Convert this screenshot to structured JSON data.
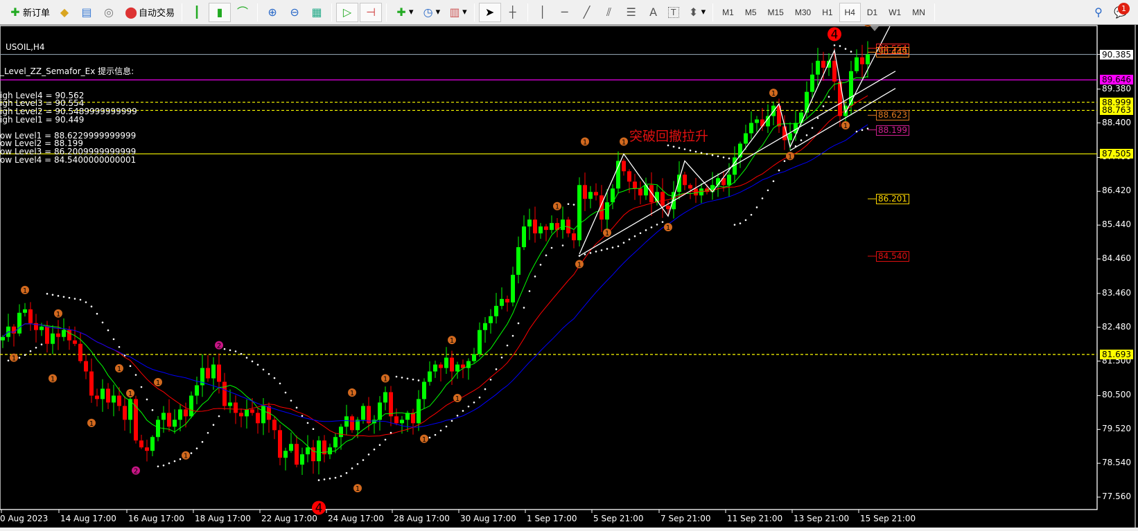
{
  "toolbar": {
    "new_order": "新订单",
    "auto_trading": "自动交易",
    "timeframes": [
      "M1",
      "M5",
      "M15",
      "M30",
      "H1",
      "H4",
      "D1",
      "W1",
      "MN"
    ],
    "active_timeframe": "H4",
    "notification_count": "1",
    "icons": [
      "new-order-icon",
      "market-watch-icon",
      "data-window-icon",
      "signals-icon",
      "auto-trading-icon",
      "bar-chart-icon",
      "candlestick-icon",
      "line-chart-icon",
      "zoom-in-icon",
      "zoom-out-icon",
      "tile-windows-icon",
      "auto-scroll-icon",
      "chart-shift-icon",
      "indicators-icon",
      "periods-icon",
      "templates-icon",
      "cursor-icon",
      "crosshair-icon",
      "vertical-line-icon",
      "horizontal-line-icon",
      "trendline-icon",
      "equidistant-channel-icon",
      "fibonacci-icon",
      "text-icon",
      "text-label-icon",
      "arrows-icon",
      "search-icon",
      "notifications-icon"
    ],
    "text_tool": "A",
    "text_label_tool": "T"
  },
  "chart": {
    "symbol": "USOIL,H4",
    "indicator_title": "_Level_ZZ_Semafor_Ex 提示信息:",
    "info_lines": [
      "igh Level4 = 90.562",
      "igh Level3 = 90.554",
      "igh Level2 = 90.5489999999999",
      "igh Level1 = 90.449",
      "",
      "ow Level1 = 88.6229999999999",
      "ow Level2 = 88.199",
      "ow Level3 = 86.2009999999999",
      "ow Level4 = 84.5400000000001"
    ],
    "annotation": "突破回撤拉升",
    "price_ticks": [
      "90.385",
      "89.380",
      "88.400",
      "87.400",
      "86.420",
      "85.440",
      "84.460",
      "83.460",
      "82.480",
      "81.500",
      "80.500",
      "79.520",
      "78.540",
      "77.560"
    ],
    "date_ticks": [
      "0 Aug 2023",
      "14 Aug 17:00",
      "16 Aug 17:00",
      "18 Aug 17:00",
      "22 Aug 17:00",
      "24 Aug 17:00",
      "28 Aug 17:00",
      "30 Aug 17:00",
      "1 Sep 17:00",
      "5 Sep 21:00",
      "7 Sep 21:00",
      "11 Sep 21:00",
      "13 Sep 21:00",
      "15 Sep 21:00"
    ],
    "hlines": [
      {
        "price": 90.385,
        "label": "90.385",
        "color": "#8a9aa8",
        "style": "solid",
        "label_bg": "#ffffff",
        "label_fg": "#000000"
      },
      {
        "price": 89.646,
        "label": "89.646",
        "color": "#ff00ff",
        "style": "solid",
        "label_bg": "#ff00ff",
        "label_fg": "#000000"
      },
      {
        "price": 88.999,
        "label": "88.999",
        "color": "#ffff00",
        "style": "dashed",
        "label_bg": "#ffff00",
        "label_fg": "#000000"
      },
      {
        "price": 88.763,
        "label": "88.763",
        "color": "#ffff00",
        "style": "dashed",
        "label_bg": "#ffff00",
        "label_fg": "#000000"
      },
      {
        "price": 87.505,
        "label": "87.505",
        "color": "#ffff00",
        "style": "solid",
        "label_bg": "#ffff00",
        "label_fg": "#000000"
      },
      {
        "price": 81.693,
        "label": "81.693",
        "color": "#ffff00",
        "style": "dashed",
        "label_bg": "#ffff00",
        "label_fg": "#000000"
      }
    ],
    "level_labels": [
      {
        "price": 90.562,
        "label": "90.554",
        "color": "#ff2020"
      },
      {
        "price": 90.449,
        "label": "90.449",
        "color": "#ff8c1a"
      },
      {
        "price": 88.623,
        "label": "88.623",
        "color": "#e07820"
      },
      {
        "price": 88.199,
        "label": "88.199",
        "color": "#d02090"
      },
      {
        "price": 86.201,
        "label": "86.201",
        "color": "#ffd700"
      },
      {
        "price": 84.54,
        "label": "84.540",
        "color": "#e01010"
      }
    ],
    "colors": {
      "bull": "#00ff00",
      "bear": "#ff0000",
      "ma_fast": "#00ff00",
      "ma_mid": "#ff0000",
      "ma_slow": "#0000ff",
      "sar": "#ffffff",
      "semafor1": "#d2691e",
      "semafor2": "#c71585",
      "semafor4": "#ff0000"
    }
  },
  "chart_data": {
    "type": "candlestick",
    "symbol": "USOIL",
    "timeframe": "H4",
    "ylim": [
      77.2,
      91.6
    ],
    "closes": [
      82.2,
      82.5,
      82.3,
      82.9,
      83.0,
      82.6,
      82.4,
      82.5,
      82.0,
      82.3,
      82.2,
      82.4,
      82.1,
      82.0,
      81.5,
      81.2,
      80.5,
      80.4,
      80.7,
      80.3,
      80.5,
      80.2,
      79.8,
      80.4,
      79.2,
      79.0,
      78.9,
      79.3,
      79.8,
      80.0,
      79.6,
      79.8,
      80.1,
      79.9,
      80.5,
      80.8,
      81.3,
      81.0,
      81.4,
      80.9,
      80.2,
      80.3,
      80.0,
      79.9,
      80.1,
      80.0,
      79.7,
      80.2,
      79.8,
      79.5,
      78.7,
      78.9,
      79.1,
      78.5,
      78.8,
      79.0,
      78.6,
      79.2,
      78.8,
      79.0,
      79.3,
      79.6,
      79.9,
      79.5,
      79.8,
      80.2,
      79.7,
      79.8,
      80.3,
      80.6,
      79.9,
      79.7,
      79.8,
      80.0,
      79.7,
      80.4,
      80.9,
      81.2,
      81.4,
      81.3,
      81.6,
      81.2,
      81.4,
      81.3,
      81.5,
      81.7,
      82.4,
      82.6,
      82.8,
      83.1,
      83.3,
      83.2,
      84.0,
      84.8,
      85.4,
      85.6,
      85.2,
      85.4,
      85.3,
      85.5,
      85.3,
      85.6,
      85.2,
      85.0,
      86.6,
      86.2,
      86.4,
      86.3,
      85.6,
      86.1,
      86.5,
      87.3,
      87.0,
      86.7,
      86.5,
      86.3,
      86.6,
      86.1,
      86.4,
      86.0,
      85.9,
      86.4,
      86.9,
      86.6,
      86.5,
      86.3,
      86.5,
      86.4,
      86.6,
      86.8,
      86.6,
      86.9,
      87.4,
      87.8,
      88.1,
      88.4,
      88.5,
      88.3,
      88.6,
      88.9,
      88.3,
      87.9,
      88.1,
      88.4,
      88.7,
      89.3,
      89.8,
      90.2,
      90.0,
      90.2,
      89.6,
      88.6,
      88.9,
      89.9,
      90.3,
      90.1,
      90.385
    ],
    "ma_periods": {
      "fast": 8,
      "mid": 21,
      "slow": 34
    },
    "zigzag": [
      [
        104,
        84.6
      ],
      [
        112,
        87.5
      ],
      [
        120,
        85.7
      ],
      [
        123,
        87.3
      ],
      [
        128,
        86.4
      ],
      [
        140,
        88.95
      ],
      [
        142,
        87.7
      ],
      [
        150,
        90.5
      ],
      [
        152,
        88.7
      ],
      [
        160,
        91.2
      ]
    ],
    "trendlines": [
      [
        [
          104,
          84.55
        ],
        [
          161,
          89.9
        ]
      ],
      [
        [
          142,
          87.6
        ],
        [
          161,
          89.4
        ]
      ]
    ],
    "semafor": [
      [
        4,
        83.56,
        "1"
      ],
      [
        10,
        82.88,
        "1"
      ],
      [
        2,
        81.6,
        "1"
      ],
      [
        9,
        81.0,
        "1"
      ],
      [
        16,
        79.71,
        "1"
      ],
      [
        21,
        81.29,
        "1"
      ],
      [
        28,
        80.89,
        "1"
      ],
      [
        23,
        80.57,
        "1"
      ],
      [
        33,
        78.77,
        "1"
      ],
      [
        24,
        78.33,
        "2"
      ],
      [
        39,
        81.96,
        "2"
      ],
      [
        63,
        80.59,
        "1"
      ],
      [
        69,
        81.0,
        "1"
      ],
      [
        64,
        77.82,
        "1"
      ],
      [
        81,
        82.11,
        "1"
      ],
      [
        82,
        80.43,
        "1"
      ],
      [
        76,
        79.25,
        "1"
      ],
      [
        100,
        85.99,
        "1"
      ],
      [
        105,
        87.86,
        "1"
      ],
      [
        112,
        87.86,
        "1"
      ],
      [
        109,
        85.22,
        "1"
      ],
      [
        104,
        84.31,
        "1"
      ],
      [
        120,
        85.38,
        "1"
      ],
      [
        139,
        89.27,
        "1"
      ],
      [
        142,
        87.44,
        "1"
      ],
      [
        152,
        88.33,
        "1"
      ],
      [
        156,
        91.31,
        "1"
      ],
      [
        150,
        90.97,
        "4"
      ],
      [
        57,
        77.25,
        "4"
      ]
    ]
  }
}
